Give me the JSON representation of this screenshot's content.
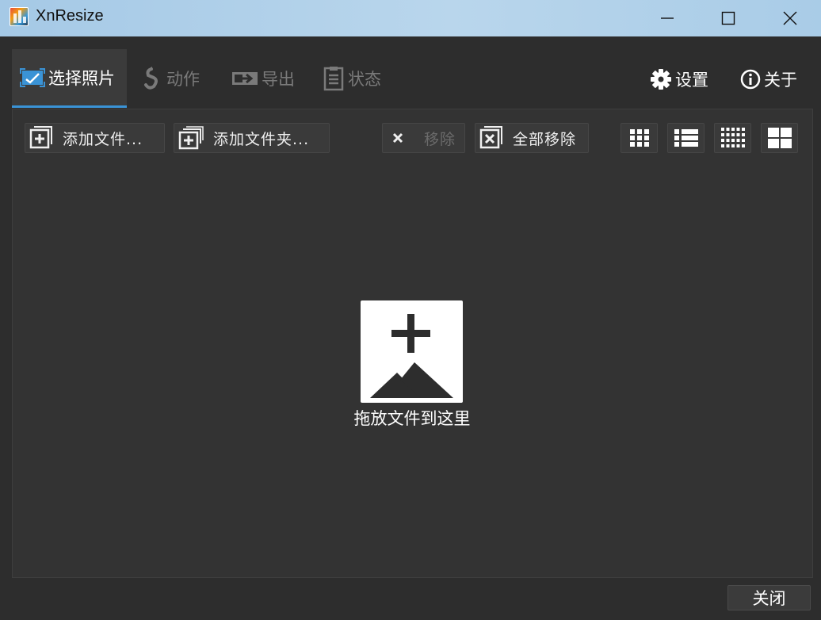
{
  "window": {
    "title": "XnResize"
  },
  "tabs": [
    {
      "label": "选择照片",
      "icon": "select-photos-icon",
      "active": true
    },
    {
      "label": "动作",
      "icon": "actions-icon",
      "active": false
    },
    {
      "label": "导出",
      "icon": "export-icon",
      "active": false
    },
    {
      "label": "状态",
      "icon": "status-icon",
      "active": false
    }
  ],
  "top_right": {
    "settings_label": "设置",
    "about_label": "关于"
  },
  "toolbar": {
    "add_files_label": "添加文件...",
    "add_folder_label": "添加文件夹...",
    "remove_label": "移除",
    "remove_all_label": "全部移除",
    "view_modes": [
      "small-thumbnails-view-icon",
      "list-view-icon",
      "tiny-thumbnails-view-icon",
      "large-thumbnails-view-icon"
    ]
  },
  "drop_zone": {
    "text": "拖放文件到这里"
  },
  "footer": {
    "close_label": "关闭"
  },
  "colors": {
    "accent": "#3a93d6",
    "background": "#2d2d2d",
    "panel": "#333333",
    "titlebar": "#b3d2ea"
  }
}
